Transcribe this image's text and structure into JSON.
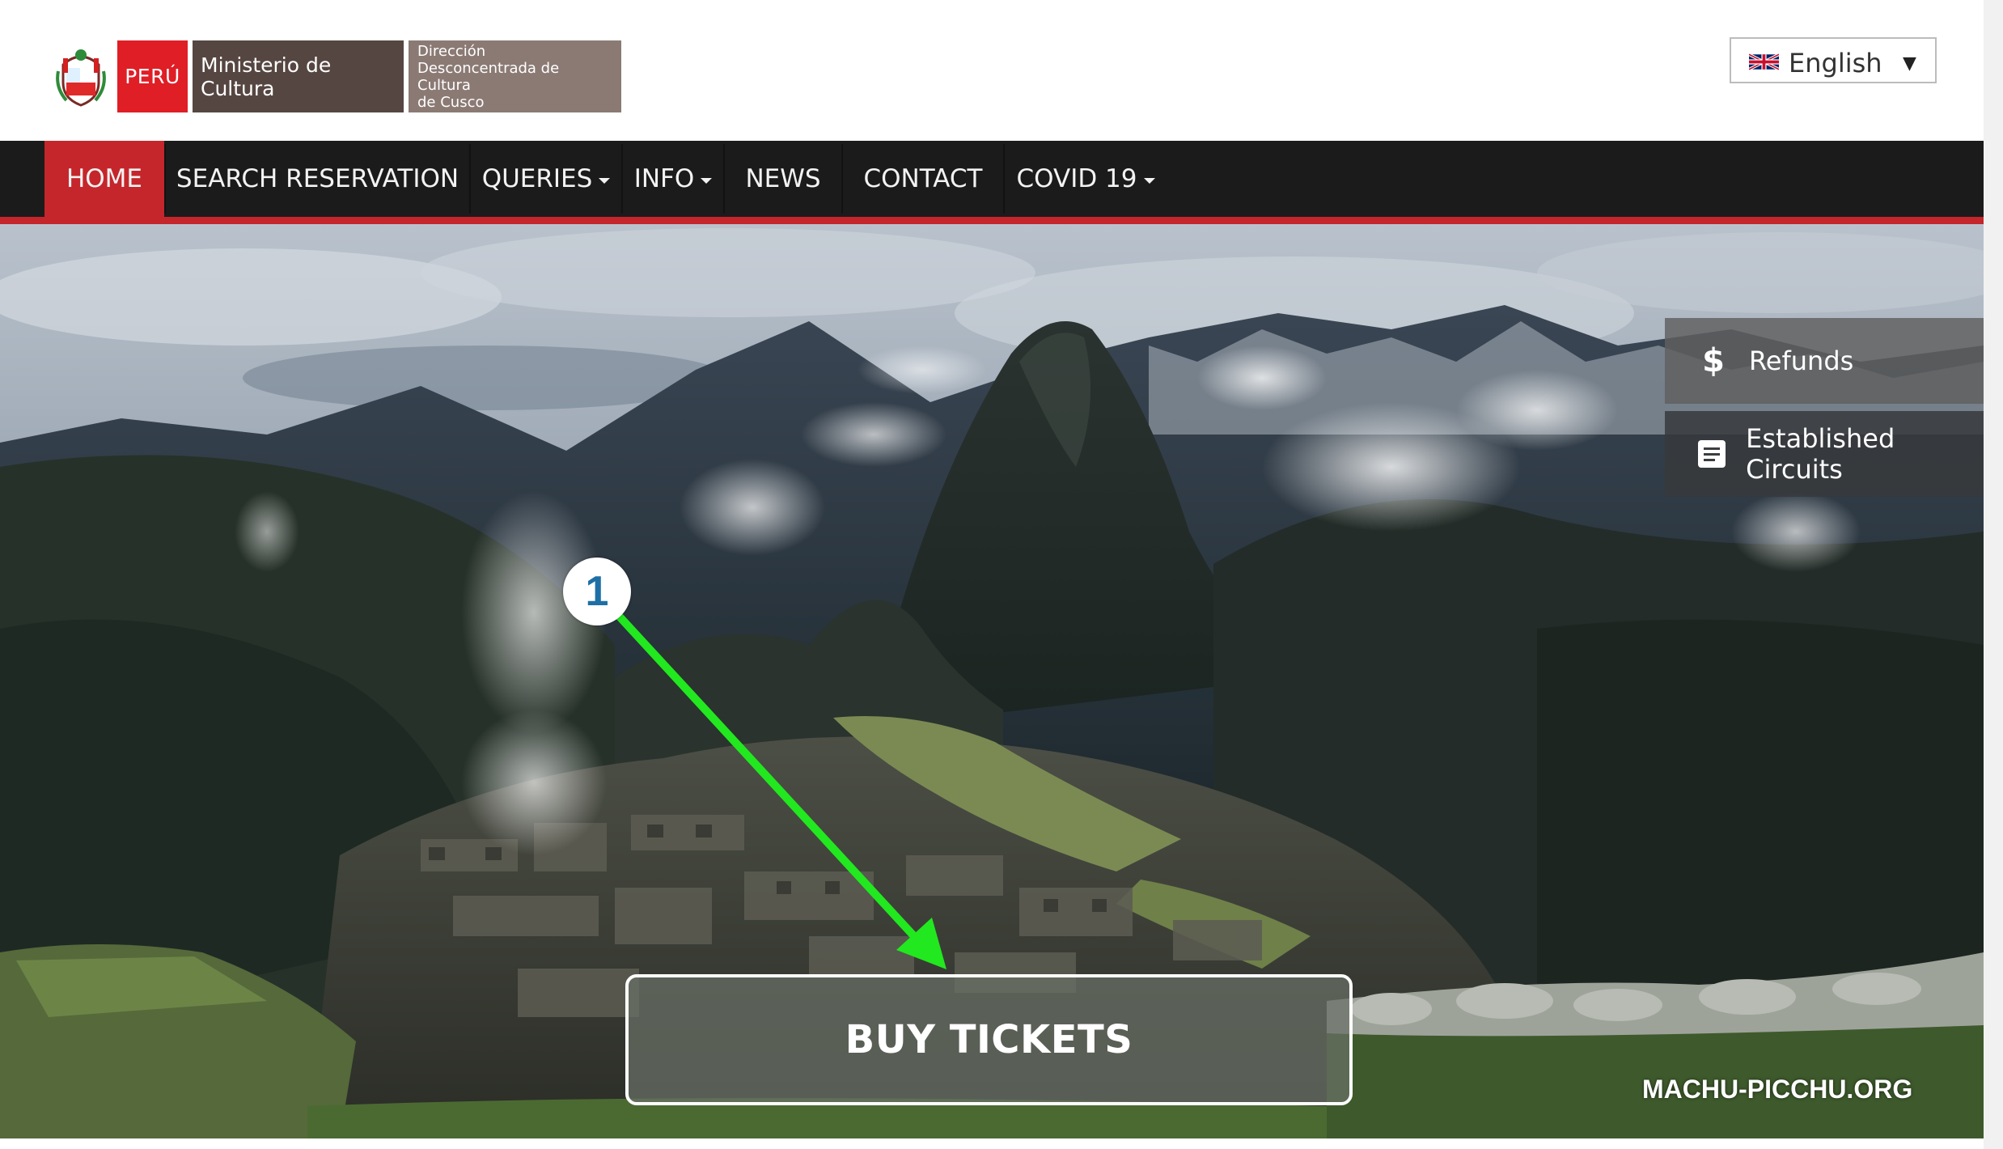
{
  "header": {
    "logo": {
      "peru": "PERÚ",
      "ministerio": "Ministerio de Cultura",
      "direccion_lines": [
        "Dirección",
        "Desconcentrada de Cultura",
        "de Cusco"
      ]
    },
    "language": {
      "selected": "English",
      "flag_icon": "uk-flag-icon",
      "caret_icon": "triangle-down-icon"
    }
  },
  "nav": {
    "home": "HOME",
    "search_reservation": "SEARCH RESERVATION",
    "queries": "QUERIES",
    "info": "INFO",
    "news": "NEWS",
    "contact": "CONTACT",
    "covid": "COVID 19",
    "active": "HOME"
  },
  "hero": {
    "side_tabs": [
      {
        "label": "Refunds",
        "icon": "dollar-icon"
      },
      {
        "label": "Established Circuits",
        "icon": "document-icon"
      }
    ],
    "buy_tickets": "BUY TICKETS",
    "watermark": "MACHU-PICCHU.ORG"
  },
  "annotation": {
    "step_number": "1",
    "arrow_color": "#22e81f"
  },
  "colors": {
    "accent_red": "#c5262b",
    "peru_red": "#e01e26",
    "nav_bg": "#1c1b1b",
    "ministerio_brown": "#564641",
    "direccion_brown": "#8b7a74"
  }
}
